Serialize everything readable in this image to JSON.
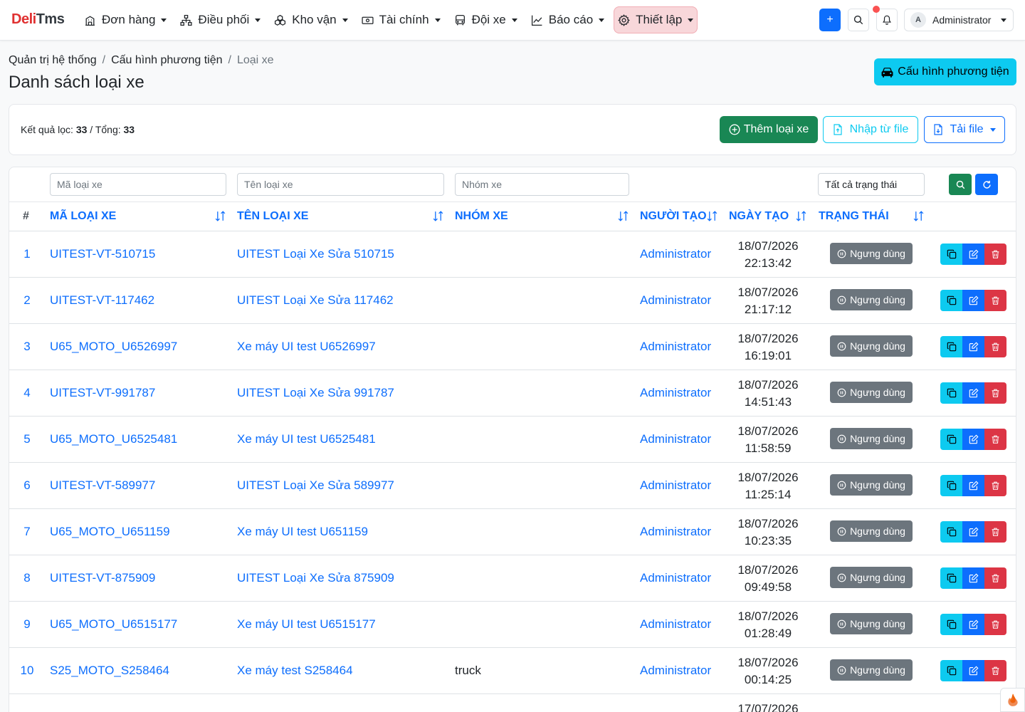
{
  "brand": {
    "part1": "Deli",
    "part2": "Tms"
  },
  "menu": [
    {
      "label": "Đơn hàng",
      "icon": "building-icon"
    },
    {
      "label": "Điều phối",
      "icon": "sitemap-icon"
    },
    {
      "label": "Kho vận",
      "icon": "boxes-icon"
    },
    {
      "label": "Tài chính",
      "icon": "cash-icon"
    },
    {
      "label": "Đội xe",
      "icon": "bus-icon"
    },
    {
      "label": "Báo cáo",
      "icon": "chart-line-icon"
    },
    {
      "label": "Thiết lập",
      "icon": "gear-icon",
      "active": true
    }
  ],
  "user": {
    "initial": "A",
    "name": "Administrator"
  },
  "breadcrumb": {
    "level1": "Quản trị hệ thống",
    "level2": "Cấu hình phương tiện",
    "current": "Loại xe",
    "separator": "/"
  },
  "page_title": "Danh sách loại xe",
  "config_button": "Cấu hình phương tiện",
  "summary": {
    "filtered_label": "Kết quả lọc:",
    "filtered": "33",
    "total_label": "/ Tổng:",
    "total": "33"
  },
  "actions": {
    "add": "Thêm loại xe",
    "import": "Nhập từ file",
    "download": "Tải file"
  },
  "filters": {
    "code_placeholder": "Mã loại xe",
    "name_placeholder": "Tên loại xe",
    "group_placeholder": "Nhóm xe",
    "status_value": "Tất cả trạng thái"
  },
  "columns": {
    "index": "#",
    "code": "MÃ LOẠI XE",
    "name": "TÊN LOẠI XE",
    "group": "NHÓM XE",
    "creator": "NGƯỜI TẠO",
    "date": "NGÀY TẠO",
    "status": "TRẠNG THÁI"
  },
  "rows": [
    {
      "idx": "1",
      "code": "UITEST-VT-510715",
      "name": "UITEST Loại Xe Sửa 510715",
      "group": "",
      "creator": "Administrator",
      "date": "18/07/2026",
      "time": "22:13:42",
      "status": "Ngưng dùng"
    },
    {
      "idx": "2",
      "code": "UITEST-VT-117462",
      "name": "UITEST Loại Xe Sửa 117462",
      "group": "",
      "creator": "Administrator",
      "date": "18/07/2026",
      "time": "21:17:12",
      "status": "Ngưng dùng"
    },
    {
      "idx": "3",
      "code": "U65_MOTO_U6526997",
      "name": "Xe máy UI test U6526997",
      "group": "",
      "creator": "Administrator",
      "date": "18/07/2026",
      "time": "16:19:01",
      "status": "Ngưng dùng"
    },
    {
      "idx": "4",
      "code": "UITEST-VT-991787",
      "name": "UITEST Loại Xe Sửa 991787",
      "group": "",
      "creator": "Administrator",
      "date": "18/07/2026",
      "time": "14:51:43",
      "status": "Ngưng dùng"
    },
    {
      "idx": "5",
      "code": "U65_MOTO_U6525481",
      "name": "Xe máy UI test U6525481",
      "group": "",
      "creator": "Administrator",
      "date": "18/07/2026",
      "time": "11:58:59",
      "status": "Ngưng dùng"
    },
    {
      "idx": "6",
      "code": "UITEST-VT-589977",
      "name": "UITEST Loại Xe Sửa 589977",
      "group": "",
      "creator": "Administrator",
      "date": "18/07/2026",
      "time": "11:25:14",
      "status": "Ngưng dùng"
    },
    {
      "idx": "7",
      "code": "U65_MOTO_U651159",
      "name": "Xe máy UI test U651159",
      "group": "",
      "creator": "Administrator",
      "date": "18/07/2026",
      "time": "10:23:35",
      "status": "Ngưng dùng"
    },
    {
      "idx": "8",
      "code": "UITEST-VT-875909",
      "name": "UITEST Loại Xe Sửa 875909",
      "group": "",
      "creator": "Administrator",
      "date": "18/07/2026",
      "time": "09:49:58",
      "status": "Ngưng dùng"
    },
    {
      "idx": "9",
      "code": "U65_MOTO_U6515177",
      "name": "Xe máy UI test U6515177",
      "group": "",
      "creator": "Administrator",
      "date": "18/07/2026",
      "time": "01:28:49",
      "status": "Ngưng dùng"
    },
    {
      "idx": "10",
      "code": "S25_MOTO_S258464",
      "name": "Xe máy test S258464",
      "group": "truck",
      "creator": "Administrator",
      "date": "18/07/2026",
      "time": "00:14:25",
      "status": "Ngưng dùng"
    },
    {
      "idx": "",
      "code": "",
      "name": "",
      "group": "",
      "creator": "",
      "date": "17/07/2026",
      "time": "",
      "status": ""
    }
  ],
  "colors": {
    "primary": "#0d6efd",
    "success": "#198754",
    "info": "#0dcaf0",
    "danger": "#dc3545",
    "secondary": "#6c757d",
    "brand_red": "#e03131"
  }
}
